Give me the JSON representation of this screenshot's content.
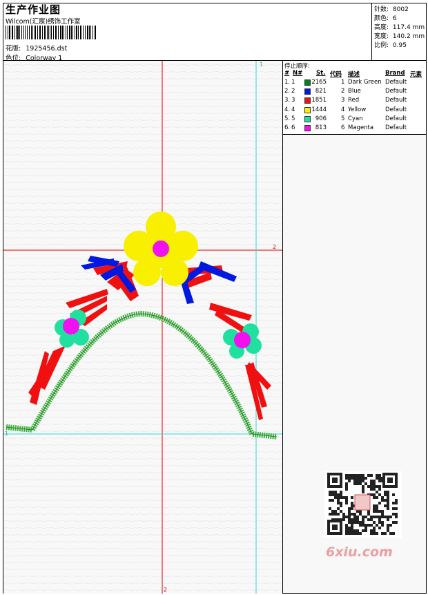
{
  "header": {
    "title": "生产作业图",
    "company": "Wilcom(汇宸)绣饰工作室",
    "design_label": "花版:",
    "design_value": "1925456.dst",
    "colorway_label": "色位:",
    "colorway_value": "Colorway 1"
  },
  "info": [
    {
      "label": "针数:",
      "value": "8002"
    },
    {
      "label": "颜色:",
      "value": "6"
    },
    {
      "label": "高度:",
      "value": "117.4 mm"
    },
    {
      "label": "宽度:",
      "value": "140.2 mm"
    },
    {
      "label": "比例:",
      "value": "0.95"
    }
  ],
  "stop_sequence": {
    "title": "停止顺序:",
    "headers": [
      "#",
      "N#",
      "St.",
      "代码",
      "描述",
      "Brand",
      "元素"
    ],
    "rows": [
      {
        "num": "1.",
        "n": "1",
        "color": "#008020",
        "st": "2165",
        "code": "1",
        "desc": "Dark Green",
        "brand": "Default"
      },
      {
        "num": "2.",
        "n": "2",
        "color": "#0018e0",
        "st": "821",
        "code": "2",
        "desc": "Blue",
        "brand": "Default"
      },
      {
        "num": "3.",
        "n": "3",
        "color": "#f01010",
        "st": "1851",
        "code": "3",
        "desc": "Red",
        "brand": "Default"
      },
      {
        "num": "4.",
        "n": "4",
        "color": "#f8f000",
        "st": "1444",
        "code": "4",
        "desc": "Yellow",
        "brand": "Default"
      },
      {
        "num": "5.",
        "n": "5",
        "color": "#20e0a0",
        "st": "906",
        "code": "5",
        "desc": "Cyan",
        "brand": "Default"
      },
      {
        "num": "6.",
        "n": "6",
        "color": "#f010f0",
        "st": "813",
        "code": "6",
        "desc": "Magenta",
        "brand": "Default"
      }
    ]
  },
  "guides": {
    "top_cyan": "1",
    "right_red": "2",
    "bottom_red": "2",
    "left_cyan": "1"
  },
  "watermark": "6xiu.com",
  "colors": {
    "red_guide": "#e00000",
    "cyan_guide": "#30d8d0"
  }
}
